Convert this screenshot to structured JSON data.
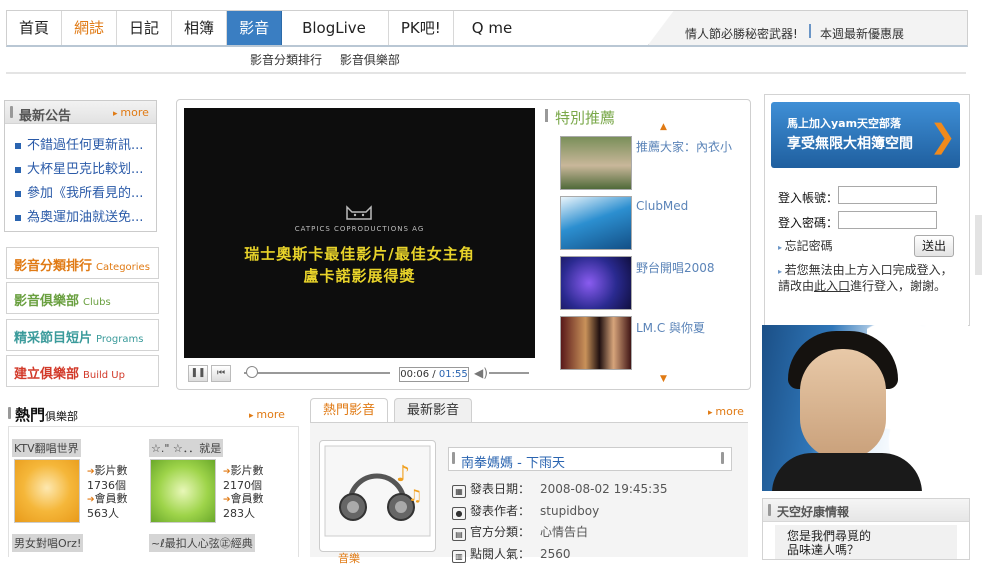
{
  "nav": {
    "tabs": [
      {
        "label": "首頁"
      },
      {
        "label": "網誌"
      },
      {
        "label": "日記"
      },
      {
        "label": "相簿"
      },
      {
        "label": "影音"
      },
      {
        "label": "BlogLive"
      },
      {
        "label": "PK吧!"
      },
      {
        "label": "Q me"
      }
    ],
    "promo_left": "情人節必勝秘密武器!",
    "promo_right": "本週最新優惠展"
  },
  "subnav": [
    "影音分類排行",
    "影音俱樂部"
  ],
  "announcements": {
    "title": "最新公告",
    "more": "more",
    "items": [
      "不錯過任何更新訊...",
      "大杯星巴克比較划...",
      "參加《我所看見的...",
      "為奧運加油就送免..."
    ]
  },
  "categories": [
    {
      "zh": "影音分類排行",
      "en": "Categories",
      "color": "#e07a14"
    },
    {
      "zh": "影音俱樂部",
      "en": "Clubs",
      "color": "#6aa040"
    },
    {
      "zh": "精采節目短片",
      "en": "Programs",
      "color": "#3b9b9b"
    },
    {
      "zh": "建立俱樂部",
      "en": "Build Up",
      "color": "#d23a2a"
    }
  ],
  "player": {
    "production": "CATPICS COPRODUCTIONS AG",
    "subtitle_line1": "瑞士奧斯卡最佳影片/最佳女主角",
    "subtitle_line2": "盧卡諾影展得獎",
    "time_current": "00:06",
    "time_total": "01:55",
    "progress": 0.05
  },
  "recommend": {
    "title": "特別推薦",
    "items": [
      {
        "label": "推薦大家：內衣小"
      },
      {
        "label": "ClubMed"
      },
      {
        "label": "野台開唱2008"
      },
      {
        "label": "LM.C 與你夏"
      }
    ]
  },
  "login": {
    "banner_line1": "馬上加入yam天空部落",
    "banner_line2": "享受無限大相簿空間",
    "account_label": "登入帳號：",
    "password_label": "登入密碼：",
    "account_value": "",
    "password_value": "",
    "forgot": "忘記密碼",
    "submit": "送出",
    "hint_1": "若您無法由上方入口完成登入，",
    "hint_2a": "請改由",
    "hint_link": "此入口",
    "hint_2b": "進行登入，謝謝。"
  },
  "health": {
    "title": "天空好康情報",
    "text_line1": "您是我們尋覓的",
    "text_line2": "品味達人嗎？"
  },
  "hot_clubs": {
    "title": "熱門",
    "subtitle": "俱樂部",
    "more": "more",
    "clubs": [
      {
        "name": "KTV翻唱世界",
        "videos_label": "影片數",
        "videos": "1736個",
        "members_label": "會員數",
        "members": "563人"
      },
      {
        "name": "☆.\" ☆．．就是",
        "videos_label": "影片數",
        "videos": "2170個",
        "members_label": "會員數",
        "members": "283人"
      },
      {
        "name": "男女對唱Orz!"
      },
      {
        "name": "~ℓ最扣人心弦㊣經典"
      }
    ]
  },
  "hot_media": {
    "tabs": [
      "熱門影音",
      "最新影音"
    ],
    "more": "more",
    "title": "南拳媽媽 - 下雨天",
    "publish_date_label": "發表日期：",
    "publish_date": "2008-08-02 19:45:35",
    "author_label": "發表作者：",
    "author": "stupidboy",
    "category_label": "官方分類：",
    "category": "心情告白",
    "views_label": "點閱人氣：",
    "views": "2560",
    "thumb_caption": "音樂"
  }
}
